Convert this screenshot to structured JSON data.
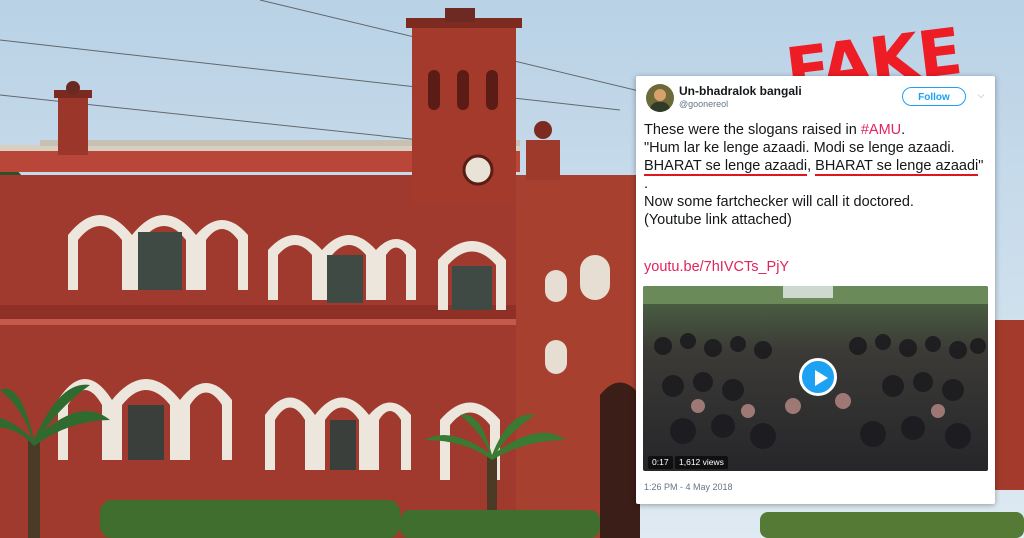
{
  "stamp": {
    "text": "FAKE",
    "color": "#ee1c25"
  },
  "tweet": {
    "display_name": "Un-bhadralok bangali",
    "handle": "@goonereol",
    "follow_label": "Follow",
    "chevron_icon": "chevron-down-icon",
    "text_line1_prefix": "These were the slogans raised in ",
    "hashtag": "#AMU",
    "text_line1_suffix": ".",
    "text_quote_start": "\"Hum lar ke lenge azaadi. Modi se lenge azaadi. ",
    "underlined_1": "BHARAT se lenge azaadi",
    "text_comma": ", ",
    "underlined_2": "BHARAT se lenge azaadi",
    "text_quote_end": "\" .",
    "text_line_doctored": "Now some fartchecker will call it doctored.",
    "text_line_youtube": "(Youtube link attached)",
    "link": "youtu.be/7hIVCTs_PjY",
    "video": {
      "duration": "0:17",
      "views": "1,612 views",
      "play_icon": "play-icon"
    },
    "timestamp": "1:26 PM - 4 May 2018",
    "link_color": "#e0245e",
    "accent": "#1da1f2"
  }
}
